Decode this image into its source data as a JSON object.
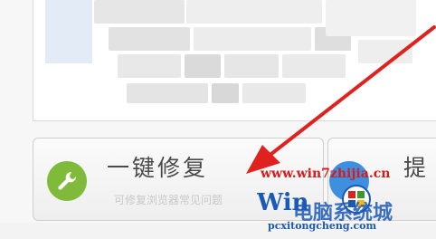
{
  "repair_card": {
    "title": "一键修复",
    "subtitle": "可修复浏览器常见问题"
  },
  "right_card": {
    "title_partial": "提"
  },
  "watermark": {
    "url": "www.win7zhijia.cn",
    "logo_text": "Win7系统之家",
    "logo_chinese": "电脑系统城",
    "logo_site": "pcxitongcheng.com"
  },
  "colors": {
    "wrench_green": "#7fba3a",
    "right_icon_blue": "#3d8fe0",
    "arrow_red": "#e0221f",
    "watermark_red": "#d61b1b",
    "logo_blue": "#1b59b8"
  },
  "icons": {
    "repair": "wrench-icon",
    "annotation": "red-arrow-icon",
    "logo": "windows-logo-icon"
  }
}
